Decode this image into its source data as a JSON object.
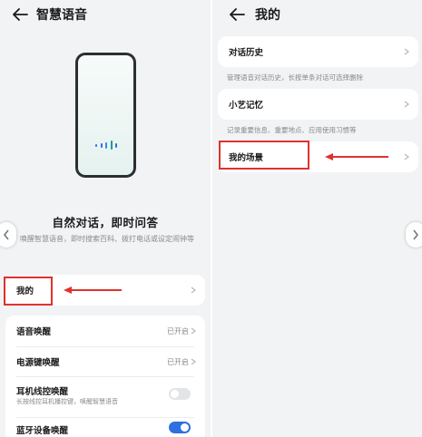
{
  "left_screen": {
    "title": "智慧语音",
    "hero_title": "自然对话，即时问答",
    "hero_subtitle": "唤醒智慧语音，即时搜索百科、拨打电话或设定闹钟等",
    "my_item": {
      "label": "我的"
    },
    "settings": [
      {
        "label": "语音唤醒",
        "value": "已开启"
      },
      {
        "label": "电源键唤醒",
        "value": "已开启"
      },
      {
        "label": "耳机线控唤醒",
        "subtitle": "长按线控耳机播控键，唤醒智慧语音",
        "toggle": "off"
      },
      {
        "label": "蓝牙设备唤醒",
        "toggle": "on"
      }
    ]
  },
  "right_screen": {
    "title": "我的",
    "items": [
      {
        "label": "对话历史",
        "description": "管理语音对话历史，长按单条对话可选择删除"
      },
      {
        "label": "小艺记忆",
        "description": "记录重要信息、重要地点、应用使用习惯等"
      },
      {
        "label": "我的场景"
      }
    ]
  },
  "colors": {
    "accent": "#2f6fe0",
    "annotation": "#e0322c",
    "background": "#f1f3f5"
  },
  "icons": [
    "back-arrow-icon",
    "chevron-right-icon",
    "voice-wave-icon",
    "prev-arrow-icon",
    "next-arrow-icon"
  ]
}
